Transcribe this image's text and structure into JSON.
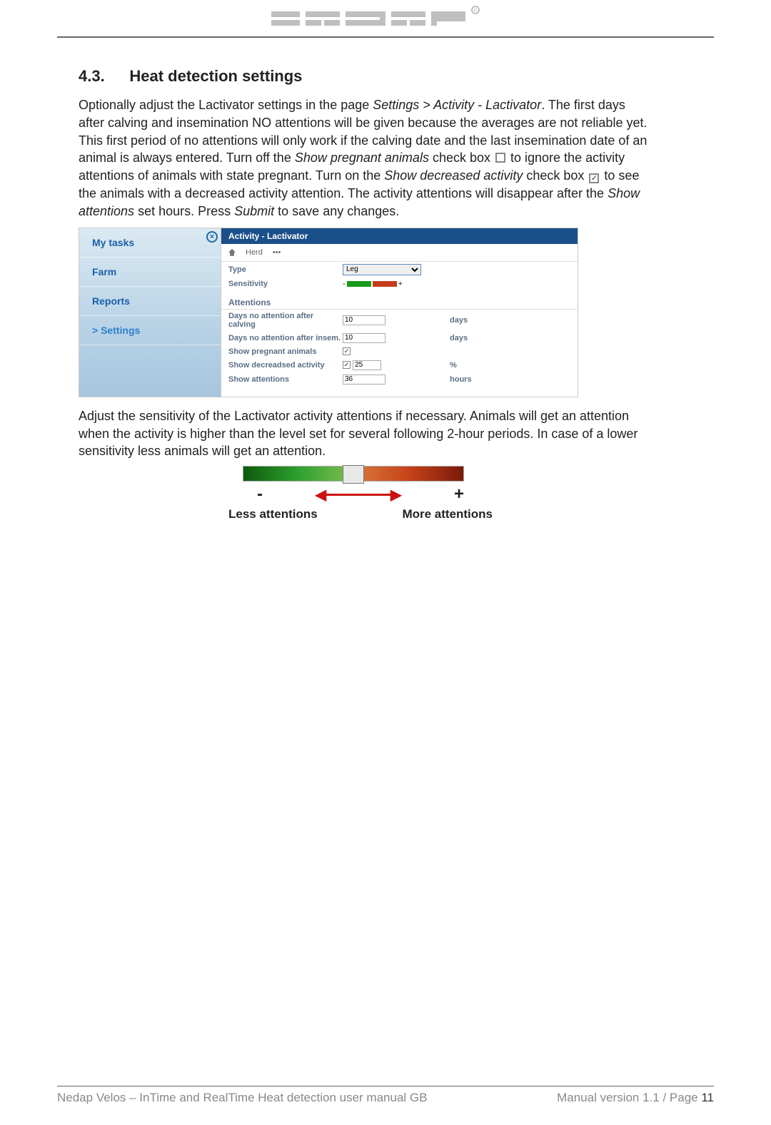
{
  "header": {
    "brand": "nedap"
  },
  "section": {
    "number": "4.3.",
    "title": "Heat detection settings"
  },
  "para1": {
    "t1": "Optionally adjust the Lactivator settings in the page ",
    "i1": "Settings > Activity - Lactivator",
    "t2": ". The first days after calving and insemination NO attentions will be given because the averages are not reliable yet. This first period of no attentions will only work if the calving date and the last insemination date of an animal is always entered. Turn off the ",
    "i2": "Show pregnant animals",
    "t3": " check box ",
    "t4": " to ignore the activity attentions of animals with state pregnant. Turn on the ",
    "i3": "Show decreased activity",
    "t5": " check box ",
    "t6": " to see the animals with a decreased activity attention. The activity attentions will disappear after the ",
    "i4": "Show attentions",
    "t7": " set hours. Press ",
    "i5": "Submit",
    "t8": " to save any changes."
  },
  "sidebar": {
    "items": [
      {
        "label": "My tasks"
      },
      {
        "label": "Farm"
      },
      {
        "label": "Reports"
      },
      {
        "label": "> Settings"
      }
    ]
  },
  "panel": {
    "title": "Activity - Lactivator",
    "crumb1": "Herd",
    "crumb2": "•••",
    "type_label": "Type",
    "type_value": "Leg",
    "sensitivity_label": "Sensitivity",
    "attentions_header": "Attentions",
    "rows": [
      {
        "label": "Days no attention after calving",
        "value": "10",
        "unit": "days"
      },
      {
        "label": "Days no attention after insem.",
        "value": "10",
        "unit": "days"
      },
      {
        "label": "Show pregnant animals",
        "value": "",
        "unit": "",
        "check": true
      },
      {
        "label": "Show decreadsed activity",
        "value": "25",
        "unit": "%",
        "check": true
      },
      {
        "label": "Show attentions",
        "value": "36",
        "unit": "hours"
      }
    ]
  },
  "para2": "Adjust the sensitivity of the Lactivator activity attentions if necessary. Animals will get an attention when the activity is higher than the level set for several following 2-hour periods. In case of a lower sensitivity less animals will get an attention.",
  "slider": {
    "minus": "-",
    "plus": "+",
    "less": "Less attentions",
    "more": "More attentions"
  },
  "footer": {
    "left": "Nedap Velos – InTime and RealTime Heat detection user manual GB",
    "right_prefix": "Manual version 1.1 / Page ",
    "page": "11"
  }
}
